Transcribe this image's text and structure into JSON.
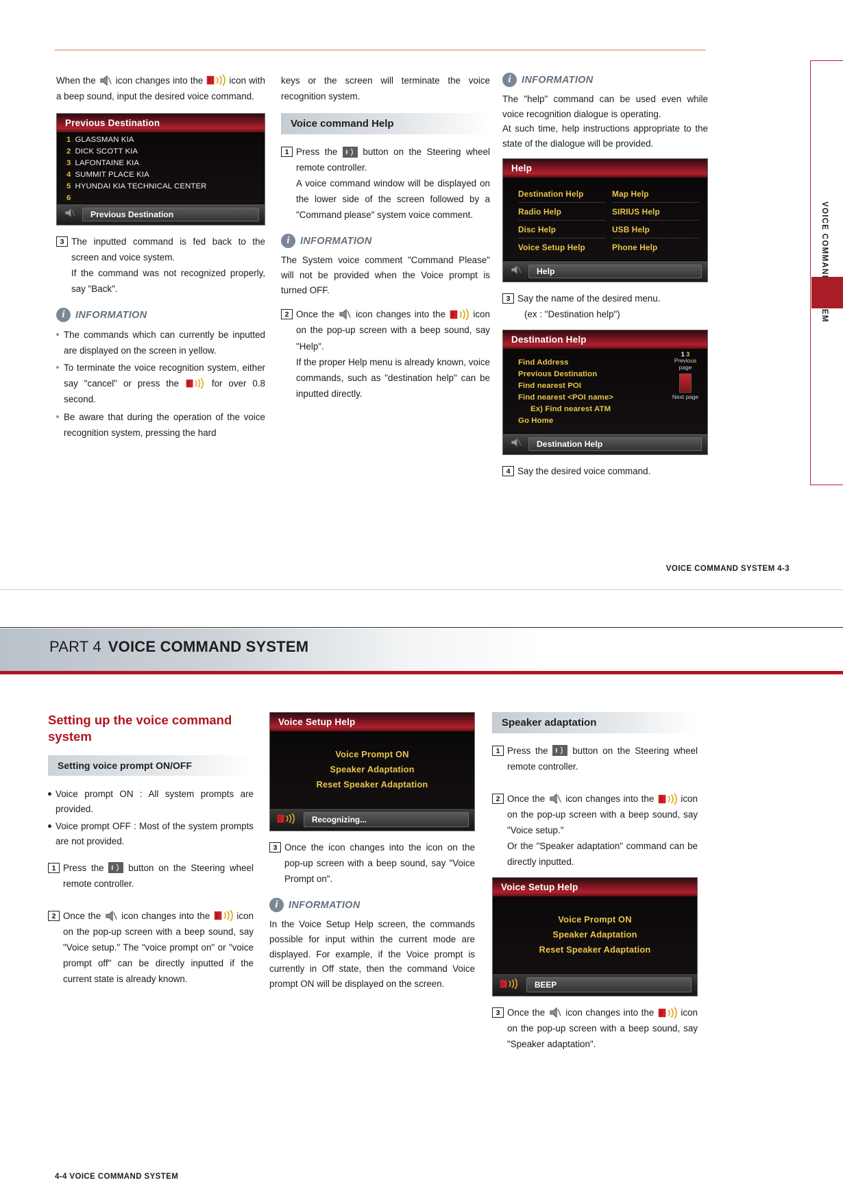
{
  "document": {
    "part_number": "PART 4",
    "part_title": "VOICE COMMAND SYSTEM",
    "side_tab_label": "VOICE COMMAND SYSTEM",
    "footer_page1": "VOICE COMMAND SYSTEM   4-3",
    "footer_page2": "4-4   VOICE COMMAND SYSTEM",
    "info_label": "INFORMATION"
  },
  "page1": {
    "col1": {
      "intro_a": "When the",
      "intro_b": "icon changes into the",
      "intro_c": "icon with a beep sound, input the desired voice command.",
      "screenshot": {
        "title": "Previous Destination",
        "rows": [
          {
            "num": "1",
            "text": "GLASSMAN KIA"
          },
          {
            "num": "2",
            "text": "DICK SCOTT KIA"
          },
          {
            "num": "3",
            "text": "LAFONTAINE KIA"
          },
          {
            "num": "4",
            "text": "SUMMIT PLACE KIA"
          },
          {
            "num": "5",
            "text": "HYUNDAI KIA TECHNICAL CENTER"
          },
          {
            "num": "6",
            "text": ""
          }
        ],
        "footer": "Previous Destination"
      },
      "step3_num": "3",
      "step3_text": "The inputted command is fed back to the screen and voice system.",
      "step3_text2": "If the command was not recognized properly, say \"Back\".",
      "bullets": [
        "The commands which can currently be inputted are displayed on the screen in yellow.",
        "To terminate the voice recognition system, either say \"cancel\" or press the",
        "Be aware that during the operation of the voice recognition system, pressing the hard"
      ],
      "bullet2_tail": "for over 0.8  second."
    },
    "col2": {
      "cont_text": "keys or the screen will terminate the voice recognition system.",
      "section_title": "Voice command Help",
      "step1_num": "1",
      "step1_a": "Press the",
      "step1_b": "button on the Steering wheel remote controller.",
      "step1_c": "A voice command window will be displayed on the lower side of the screen followed by a \"Command please\" system voice comment.",
      "info_text": "The System voice comment \"Command Please\" will not be provided when the Voice prompt is turned OFF.",
      "step2_num": "2",
      "step2_a": "Once the",
      "step2_b": "icon changes into the",
      "step2_c": "icon on the pop-up screen with a beep sound, say \"Help\".",
      "step2_d": "If the proper Help menu is already known, voice commands, such as \"destination help\" can be inputted directly."
    },
    "col3": {
      "info_text": "The \"help\" command can be used even while voice recognition dialogue is operating.\nAt such time, help instructions appropriate to the state of the dialogue will be provided.",
      "help_screenshot": {
        "title": "Help",
        "items": [
          "Destination Help",
          "Map Help",
          "Radio Help",
          "SIRIUS Help",
          "Disc Help",
          "USB Help",
          "Voice Setup Help",
          "Phone Help"
        ],
        "footer": "Help"
      },
      "step3_num": "3",
      "step3_text": "Say the name of the desired menu.",
      "step3_example": "(ex : \"Destination help\")",
      "dest_screenshot": {
        "title": "Destination Help",
        "items": [
          "Find Address",
          "Previous Destination",
          "Find nearest POI",
          "Find nearest <POI name>",
          "Ex) Find nearest ATM",
          "Go Home"
        ],
        "page_current": "1",
        "page_total": "3",
        "prev_label": "Previous page",
        "next_label": "Next page",
        "footer": "Destination Help"
      },
      "step4_num": "4",
      "step4_text": "Say the desired voice command."
    }
  },
  "page2": {
    "col1": {
      "heading": "Setting up the voice command system",
      "sub_heading": "Setting voice prompt ON/OFF",
      "bullets": [
        "Voice prompt ON : All system prompts are provided.",
        "Voice prompt OFF : Most of the system prompts are not provided."
      ],
      "step1_num": "1",
      "step1_a": "Press the",
      "step1_b": "button on the Steering wheel remote controller.",
      "step2_num": "2",
      "step2_a": "Once the",
      "step2_b": "icon changes into the",
      "step2_c": "icon on the pop-up screen with a beep sound, say \"Voice setup.\" The \"voice prompt on\" or \"voice prompt off\" can be directly inputted if the current state is already known."
    },
    "col2": {
      "screenshot": {
        "title": "Voice Setup Help",
        "commands": [
          "Voice Prompt ON",
          "Speaker Adaptation",
          "Reset Speaker Adaptation"
        ],
        "status": "Recognizing..."
      },
      "step3_num": "3",
      "step3_text": "Once the  icon changes into the icon on the pop-up screen with a beep sound, say \"Voice Prompt on\".",
      "info_text": "In the Voice Setup Help screen, the commands possible for input within the current mode are displayed. For example, if the Voice prompt is currently in Off state, then the command Voice prompt ON will be displayed on the screen."
    },
    "col3": {
      "section_title": "Speaker adaptation",
      "step1_num": "1",
      "step1_a": "Press the",
      "step1_b": "button on the Steering wheel remote controller.",
      "step2_num": "2",
      "step2_a": "Once the",
      "step2_b": "icon changes into the",
      "step2_c": "icon on the pop-up screen with a beep sound, say \"Voice setup.\"",
      "step2_d": "Or the \"Speaker adaptation\" command can be directly inputted.",
      "screenshot": {
        "title": "Voice Setup Help",
        "commands": [
          "Voice Prompt ON",
          "Speaker Adaptation",
          "Reset Speaker Adaptation"
        ],
        "status": "BEEP"
      },
      "step3_num": "3",
      "step3_a": "Once the",
      "step3_b": "icon changes into the",
      "step3_c": "icon on the pop-up screen with a beep sound, say \"Speaker adaptation\"."
    }
  },
  "colors": {
    "accent_red": "#b01522",
    "info_blue_grey": "#63707d",
    "screen_yellow": "#e8c64b"
  }
}
